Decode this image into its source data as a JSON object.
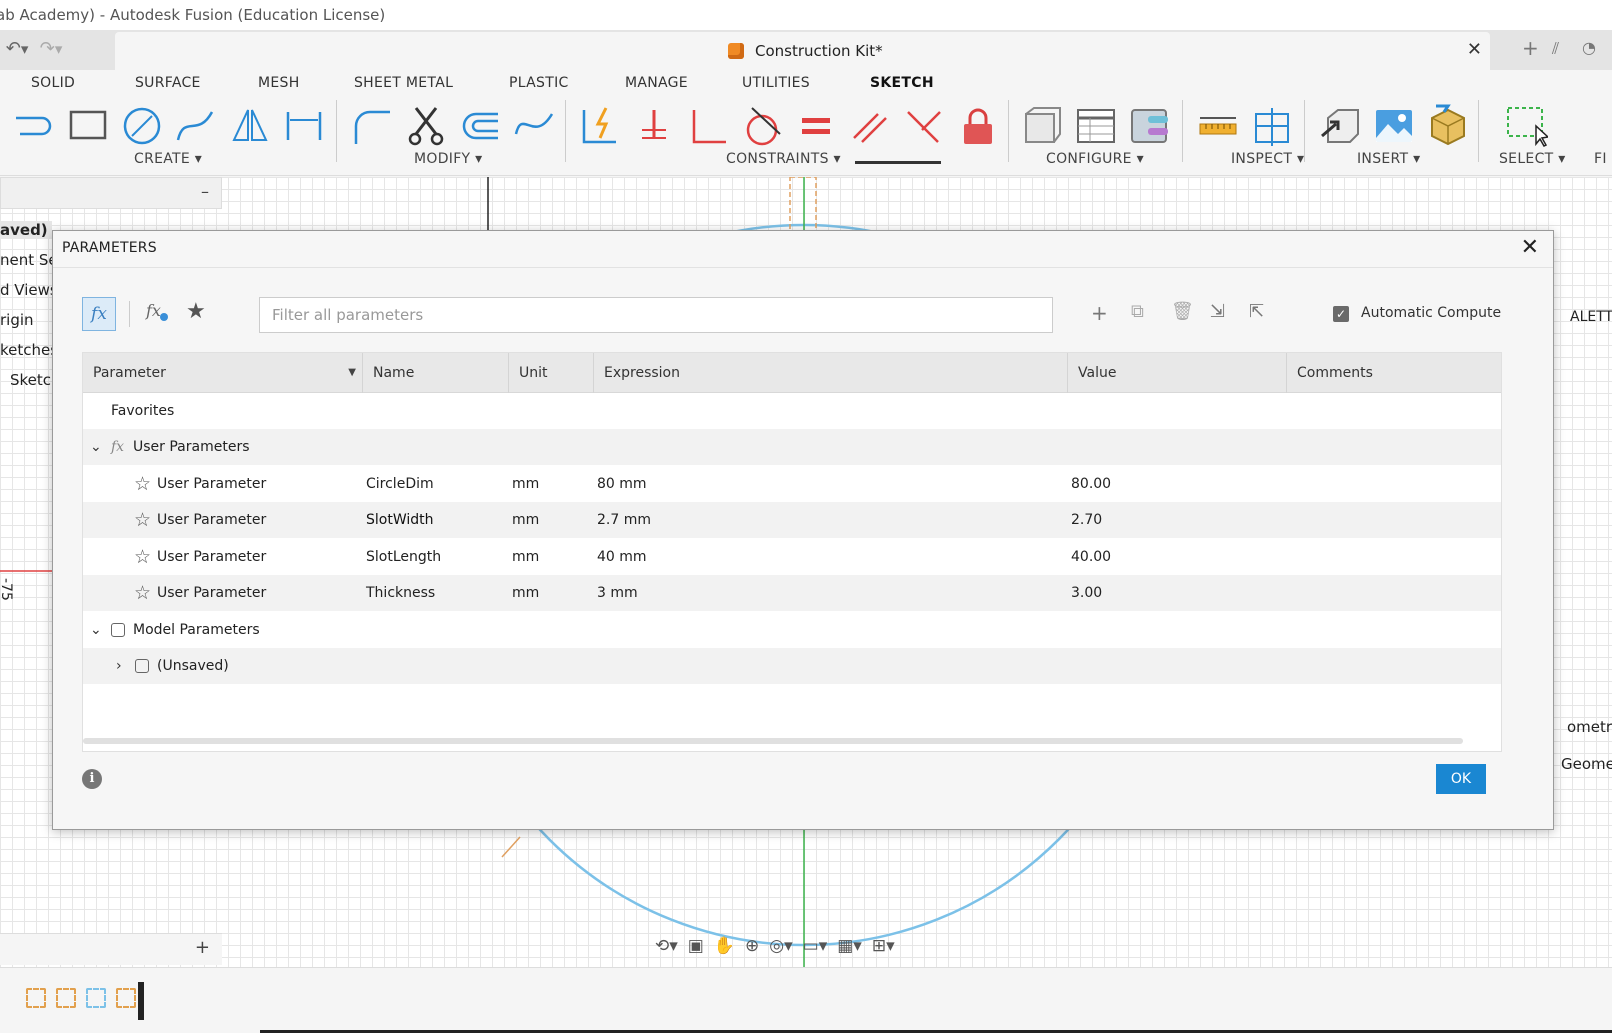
{
  "window_title": "ab Academy) - Autodesk Fusion (Education License)",
  "doc_tab": {
    "title": "Construction Kit*"
  },
  "ribbon": {
    "tabs": [
      "SOLID",
      "SURFACE",
      "MESH",
      "SHEET METAL",
      "PLASTIC",
      "MANAGE",
      "UTILITIES",
      "SKETCH"
    ],
    "active_tab": "SKETCH",
    "groups": [
      "CREATE ▾",
      "MODIFY ▾",
      "CONSTRAINTS ▾",
      "CONFIGURE ▾",
      "INSPECT ▾",
      "INSERT ▾",
      "SELECT ▾",
      "FI"
    ]
  },
  "browser": {
    "items": [
      "aved)",
      "nent Se",
      "d Views",
      "rigin",
      "ketches",
      "Sketch"
    ]
  },
  "canvas": {
    "axis_label": "-75",
    "palette_label": "ALETTE",
    "right_items": [
      "ometries",
      "Geomet"
    ]
  },
  "dialog": {
    "title": "PARAMETERS",
    "filter_placeholder": "Filter all parameters",
    "auto_compute_label": "Automatic Compute",
    "ok_label": "OK",
    "columns": [
      "Parameter",
      "Name",
      "Unit",
      "Expression",
      "Value",
      "Comments"
    ],
    "favorites_label": "Favorites",
    "user_group_label": "User Parameters",
    "model_group_label": "Model Parameters",
    "unsaved_label": "(Unsaved)",
    "user_parameters": [
      {
        "parameter": "User Parameter",
        "name": "CircleDim",
        "unit": "mm",
        "expression": "80 mm",
        "value": "80.00",
        "comments": ""
      },
      {
        "parameter": "User Parameter",
        "name": "SlotWidth",
        "unit": "mm",
        "expression": "2.7 mm",
        "value": "2.70",
        "comments": ""
      },
      {
        "parameter": "User Parameter",
        "name": "SlotLength",
        "unit": "mm",
        "expression": "40 mm",
        "value": "40.00",
        "comments": ""
      },
      {
        "parameter": "User Parameter",
        "name": "Thickness",
        "unit": "mm",
        "expression": "3 mm",
        "value": "3.00",
        "comments": ""
      }
    ]
  },
  "colors": {
    "accent": "#1a87d2",
    "sketch_curve": "#7cc1e8",
    "axis_red": "#e04040",
    "axis_green": "#3cb44b"
  }
}
